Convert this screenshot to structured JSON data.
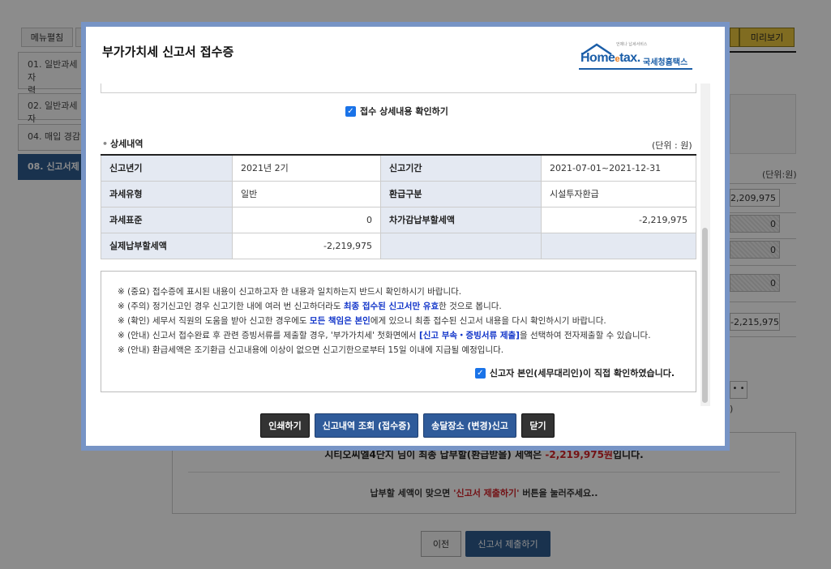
{
  "background": {
    "menu_label": "메뉴펼침",
    "preview_label": "미리보기",
    "steps": [
      {
        "label": "01. 일반과세자\n력"
      },
      {
        "label": "02. 일반과세자"
      },
      {
        "label": "04. 매입 경감"
      },
      {
        "label": "08. 신고서제"
      }
    ],
    "unit_label": "(단위:원)",
    "values": [
      "2,209,975",
      "0",
      "0",
      "0",
      "-2,215,975"
    ],
    "small_button": "• •",
    "paren": ")",
    "result_line1_prefix": "시티오씨엘4단지 님이 최종 납부할(환급받을) 세액은 ",
    "result_line1_amount": "-2,219,975원",
    "result_line1_suffix": "입니다.",
    "result_line2_prefix": "납부할 세액이 맞으면 ",
    "result_line2_highlight": "'신고서 제출하기'",
    "result_line2_suffix": " 버튼을 눌러주세요..",
    "prev_button": "이전",
    "submit_button": "신고서 제출하기"
  },
  "modal": {
    "title": "부가가치세 신고서 접수증",
    "logo": {
      "home": "Home",
      "e": "e",
      "tax": "tax.",
      "korean": "국세청홈택스",
      "sub": "언제나 납세서비스"
    },
    "confirm_detail_label": "접수 상세내용 확인하기",
    "section_title": "상세내역",
    "section_unit": "(단위 : 원)",
    "table": [
      [
        {
          "h": "신고년기"
        },
        {
          "v": "2021년 2기"
        },
        {
          "h": "신고기간"
        },
        {
          "v": "2021-07-01~2021-12-31"
        }
      ],
      [
        {
          "h": "과세유형"
        },
        {
          "v": "일반"
        },
        {
          "h": "환급구분"
        },
        {
          "v": "시설투자환급"
        }
      ],
      [
        {
          "h": "과세표준"
        },
        {
          "v": "0"
        },
        {
          "h": "차가감납부할세액"
        },
        {
          "v": "-2,219,975"
        }
      ],
      [
        {
          "h": "실제납부할세액"
        },
        {
          "v": "-2,219,975"
        },
        {
          "h": ""
        },
        {
          "v": ""
        }
      ]
    ],
    "notices": {
      "n1": "※ (중요) 접수증에 표시된 내용이 신고하고자 한 내용과 일치하는지 반드시 확인하시기 바랍니다.",
      "n2_a": "※ (주의) 정기신고인 경우 신고기한 내에 여러 번 신고하더라도 ",
      "n2_b": "최종 접수된 신고서만 유효",
      "n2_c": "한 것으로 봅니다.",
      "n3_a": "※ (확인) 세무서 직원의 도움을 받아 신고한 경우에도 ",
      "n3_b": "모든 책임은 본인",
      "n3_c": "에게 있으니 최종 접수된 신고서 내용을 다시 확인하시기 바랍니다.",
      "n4_a": "※ (안내) 신고서 접수완료 후 관련 증빙서류를 제출할 경우, '부가가치세' 첫화면에서 ",
      "n4_b": "[신고 부속・증빙서류 제출]",
      "n4_c": "을 선택하여 전자제출할 수 있습니다.",
      "n5": "※ (안내) 환급세액은 조기환급 신고내용에 이상이 없으면 신고기한으로부터 15일 이내에 지급될 예정입니다."
    },
    "self_confirm_label": "신고자 본인(세무대리인)이 직접 확인하였습니다.",
    "buttons": {
      "print": "인쇄하기",
      "history": "신고내역 조회 (접수증)",
      "address": "송달장소 (변경)신고",
      "close": "닫기"
    }
  }
}
